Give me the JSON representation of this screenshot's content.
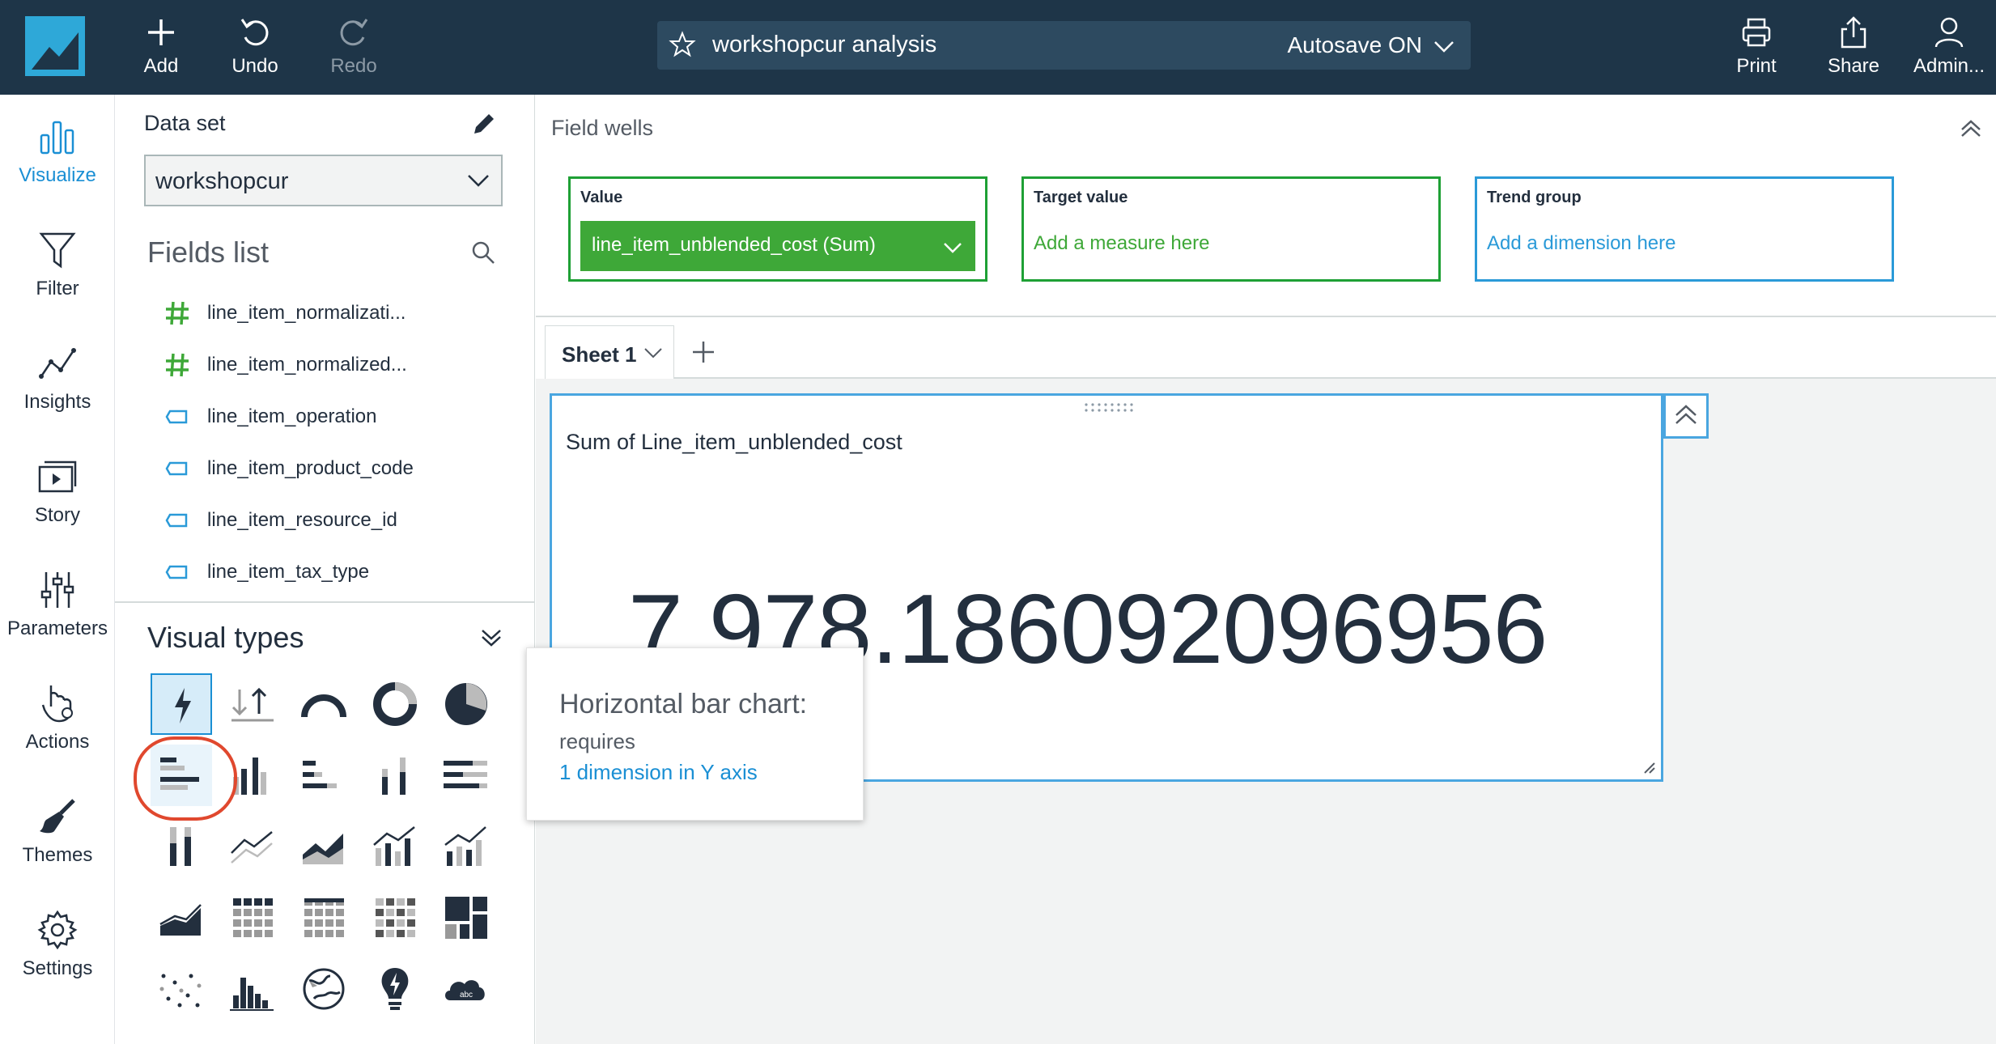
{
  "topbar": {
    "add_label": "Add",
    "undo_label": "Undo",
    "redo_label": "Redo",
    "analysis_title": "workshopcur analysis",
    "autosave_label": "Autosave ON",
    "print_label": "Print",
    "share_label": "Share",
    "admin_label": "Admin..."
  },
  "leftnav": {
    "items": [
      {
        "label": "Visualize",
        "icon": "bar-chart-icon"
      },
      {
        "label": "Filter",
        "icon": "filter-icon"
      },
      {
        "label": "Insights",
        "icon": "insights-icon"
      },
      {
        "label": "Story",
        "icon": "story-icon"
      },
      {
        "label": "Parameters",
        "icon": "parameters-icon"
      },
      {
        "label": "Actions",
        "icon": "actions-icon"
      },
      {
        "label": "Themes",
        "icon": "brush-icon"
      },
      {
        "label": "Settings",
        "icon": "gear-icon"
      }
    ]
  },
  "dataset": {
    "label": "Data set",
    "selected": "workshopcur"
  },
  "fields_list": {
    "title": "Fields list",
    "fields": [
      {
        "name": "line_item_normalizati...",
        "type": "measure"
      },
      {
        "name": "line_item_normalized...",
        "type": "measure"
      },
      {
        "name": "line_item_operation",
        "type": "dimension"
      },
      {
        "name": "line_item_product_code",
        "type": "dimension"
      },
      {
        "name": "line_item_resource_id",
        "type": "dimension"
      },
      {
        "name": "line_item_tax_type",
        "type": "dimension"
      }
    ]
  },
  "visual_types": {
    "title": "Visual types"
  },
  "field_wells": {
    "title": "Field wells",
    "value_label": "Value",
    "value_field": "line_item_unblended_cost (Sum)",
    "target_label": "Target value",
    "target_placeholder": "Add a measure here",
    "trend_label": "Trend group",
    "trend_placeholder": "Add a dimension here"
  },
  "sheet": {
    "tab_label": "Sheet 1"
  },
  "visual": {
    "title": "Sum of Line_item_unblended_cost",
    "value": "7,978.186092096956"
  },
  "tooltip": {
    "heading": "Horizontal bar chart:",
    "requires": "requires",
    "detail": "1 dimension in Y axis"
  },
  "colors": {
    "topbar": "#1e3548",
    "accent": "#1a8fd4",
    "green": "#3ea838",
    "highlight_circle": "#e0482e"
  }
}
